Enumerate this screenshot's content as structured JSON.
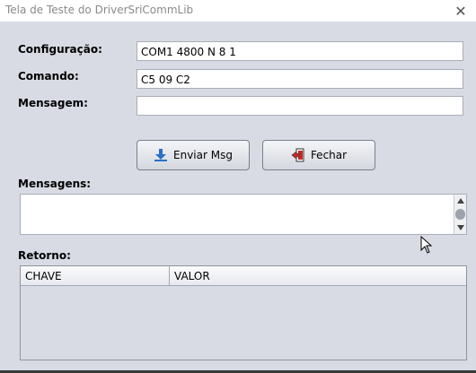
{
  "window": {
    "title": "Tela de Teste do DriverSriCommLib",
    "close_glyph": "✕"
  },
  "form": {
    "configuracao_label": "Configuração:",
    "configuracao_value": "COM1 4800 N 8 1",
    "comando_label": "Comando:",
    "comando_value": "C5 09 C2",
    "mensagem_label": "Mensagem:",
    "mensagem_value": ""
  },
  "buttons": {
    "enviar_label": "Enviar Msg",
    "enviar_icon": "download-arrow-icon",
    "fechar_label": "Fechar",
    "fechar_icon": "exit-door-icon"
  },
  "mensagens": {
    "label": "Mensagens:",
    "content": ""
  },
  "retorno": {
    "label": "Retorno:",
    "columns": [
      "CHAVE",
      "VALOR"
    ],
    "rows": []
  },
  "colors": {
    "background": "#d8dbe3",
    "field_border": "#a9adb6",
    "accent_blue": "#2a6fc9",
    "accent_red": "#c62828"
  }
}
